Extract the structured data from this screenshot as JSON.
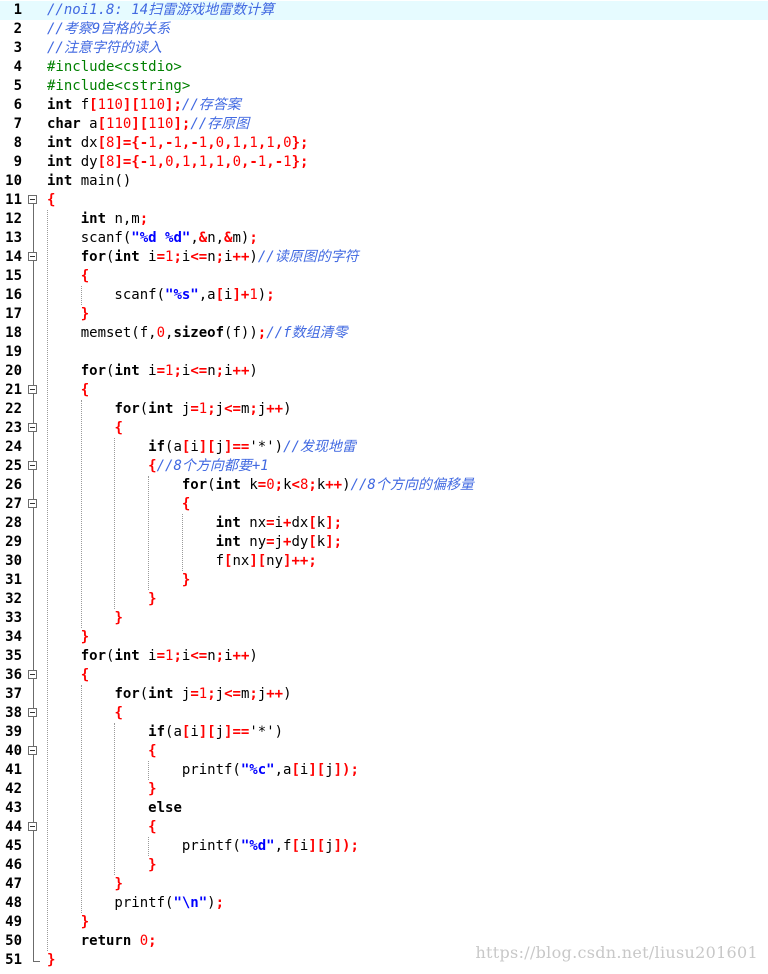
{
  "editor": {
    "current_line": 1,
    "watermark": "https://blog.csdn.net/liusu201601"
  },
  "fold_lines": [
    11,
    14,
    21,
    23,
    25,
    27,
    36,
    38,
    40,
    44
  ],
  "lines": [
    {
      "n": "1",
      "tokens": [
        [
          "cmt",
          "//noi1.8: 14扫雷游戏地雷数计算"
        ]
      ]
    },
    {
      "n": "2",
      "tokens": [
        [
          "cmt",
          "//考察9宫格的关系"
        ]
      ]
    },
    {
      "n": "3",
      "tokens": [
        [
          "cmt",
          "//注意字符的读入"
        ]
      ]
    },
    {
      "n": "4",
      "tokens": [
        [
          "pp",
          "#include<cstdio>"
        ]
      ]
    },
    {
      "n": "5",
      "tokens": [
        [
          "pp",
          "#include<cstring>"
        ]
      ]
    },
    {
      "n": "6",
      "tokens": [
        [
          "kw",
          "int"
        ],
        [
          "id",
          " f"
        ],
        [
          "op",
          "["
        ],
        [
          "num",
          "110"
        ],
        [
          "op",
          "]["
        ],
        [
          "num",
          "110"
        ],
        [
          "op",
          "];"
        ],
        [
          "cmt",
          "//存答案"
        ]
      ]
    },
    {
      "n": "7",
      "tokens": [
        [
          "kw",
          "char"
        ],
        [
          "id",
          " a"
        ],
        [
          "op",
          "["
        ],
        [
          "num",
          "110"
        ],
        [
          "op",
          "]["
        ],
        [
          "num",
          "110"
        ],
        [
          "op",
          "];"
        ],
        [
          "cmt",
          "//存原图"
        ]
      ]
    },
    {
      "n": "8",
      "tokens": [
        [
          "kw",
          "int"
        ],
        [
          "id",
          " dx"
        ],
        [
          "op",
          "["
        ],
        [
          "num",
          "8"
        ],
        [
          "op",
          "]={-"
        ],
        [
          "num",
          "1"
        ],
        [
          "op",
          ",-"
        ],
        [
          "num",
          "1"
        ],
        [
          "op",
          ",-"
        ],
        [
          "num",
          "1"
        ],
        [
          "op",
          ","
        ],
        [
          "num",
          "0"
        ],
        [
          "op",
          ","
        ],
        [
          "num",
          "1"
        ],
        [
          "op",
          ","
        ],
        [
          "num",
          "1"
        ],
        [
          "op",
          ","
        ],
        [
          "num",
          "1"
        ],
        [
          "op",
          ","
        ],
        [
          "num",
          "0"
        ],
        [
          "op",
          "};"
        ]
      ]
    },
    {
      "n": "9",
      "tokens": [
        [
          "kw",
          "int"
        ],
        [
          "id",
          " dy"
        ],
        [
          "op",
          "["
        ],
        [
          "num",
          "8"
        ],
        [
          "op",
          "]={-"
        ],
        [
          "num",
          "1"
        ],
        [
          "op",
          ","
        ],
        [
          "num",
          "0"
        ],
        [
          "op",
          ","
        ],
        [
          "num",
          "1"
        ],
        [
          "op",
          ","
        ],
        [
          "num",
          "1"
        ],
        [
          "op",
          ","
        ],
        [
          "num",
          "1"
        ],
        [
          "op",
          ","
        ],
        [
          "num",
          "0"
        ],
        [
          "op",
          ",-"
        ],
        [
          "num",
          "1"
        ],
        [
          "op",
          ",-"
        ],
        [
          "num",
          "1"
        ],
        [
          "op",
          "};"
        ]
      ]
    },
    {
      "n": "10",
      "tokens": [
        [
          "kw",
          "int"
        ],
        [
          "id",
          " main()"
        ]
      ]
    },
    {
      "n": "11",
      "tokens": [
        [
          "op",
          "{"
        ]
      ]
    },
    {
      "n": "12",
      "tokens": [
        [
          "id",
          "    "
        ],
        [
          "kw",
          "int"
        ],
        [
          "id",
          " n,m"
        ],
        [
          "op",
          ";"
        ]
      ]
    },
    {
      "n": "13",
      "tokens": [
        [
          "id",
          "    scanf("
        ],
        [
          "str",
          "\"%d %d\""
        ],
        [
          "id",
          ","
        ],
        [
          "op",
          "&"
        ],
        [
          "id",
          "n,"
        ],
        [
          "op",
          "&"
        ],
        [
          "id",
          "m)"
        ],
        [
          "op",
          ";"
        ]
      ]
    },
    {
      "n": "14",
      "tokens": [
        [
          "id",
          "    "
        ],
        [
          "kw",
          "for"
        ],
        [
          "id",
          "("
        ],
        [
          "kw",
          "int"
        ],
        [
          "id",
          " i"
        ],
        [
          "op",
          "="
        ],
        [
          "num",
          "1"
        ],
        [
          "op",
          ";"
        ],
        [
          "id",
          "i"
        ],
        [
          "op",
          "<="
        ],
        [
          "id",
          "n"
        ],
        [
          "op",
          ";"
        ],
        [
          "id",
          "i"
        ],
        [
          "op",
          "++"
        ],
        [
          "id",
          ")"
        ],
        [
          "cmt",
          "//读原图的字符"
        ]
      ]
    },
    {
      "n": "15",
      "tokens": [
        [
          "id",
          "    "
        ],
        [
          "op",
          "{"
        ]
      ]
    },
    {
      "n": "16",
      "tokens": [
        [
          "id",
          "        scanf("
        ],
        [
          "str",
          "\"%s\""
        ],
        [
          "id",
          ",a"
        ],
        [
          "op",
          "["
        ],
        [
          "id",
          "i"
        ],
        [
          "op",
          "]+"
        ],
        [
          "num",
          "1"
        ],
        [
          "id",
          ")"
        ],
        [
          "op",
          ";"
        ]
      ]
    },
    {
      "n": "17",
      "tokens": [
        [
          "id",
          "    "
        ],
        [
          "op",
          "}"
        ]
      ]
    },
    {
      "n": "18",
      "tokens": [
        [
          "id",
          "    memset(f,"
        ],
        [
          "num",
          "0"
        ],
        [
          "id",
          ","
        ],
        [
          "kw",
          "sizeof"
        ],
        [
          "id",
          "(f))"
        ],
        [
          "op",
          ";"
        ],
        [
          "cmt",
          "//f数组清零"
        ]
      ]
    },
    {
      "n": "19",
      "tokens": []
    },
    {
      "n": "20",
      "tokens": [
        [
          "id",
          "    "
        ],
        [
          "kw",
          "for"
        ],
        [
          "id",
          "("
        ],
        [
          "kw",
          "int"
        ],
        [
          "id",
          " i"
        ],
        [
          "op",
          "="
        ],
        [
          "num",
          "1"
        ],
        [
          "op",
          ";"
        ],
        [
          "id",
          "i"
        ],
        [
          "op",
          "<="
        ],
        [
          "id",
          "n"
        ],
        [
          "op",
          ";"
        ],
        [
          "id",
          "i"
        ],
        [
          "op",
          "++"
        ],
        [
          "id",
          ")"
        ]
      ]
    },
    {
      "n": "21",
      "tokens": [
        [
          "id",
          "    "
        ],
        [
          "op",
          "{"
        ]
      ]
    },
    {
      "n": "22",
      "tokens": [
        [
          "id",
          "        "
        ],
        [
          "kw",
          "for"
        ],
        [
          "id",
          "("
        ],
        [
          "kw",
          "int"
        ],
        [
          "id",
          " j"
        ],
        [
          "op",
          "="
        ],
        [
          "num",
          "1"
        ],
        [
          "op",
          ";"
        ],
        [
          "id",
          "j"
        ],
        [
          "op",
          "<="
        ],
        [
          "id",
          "m"
        ],
        [
          "op",
          ";"
        ],
        [
          "id",
          "j"
        ],
        [
          "op",
          "++"
        ],
        [
          "id",
          ")"
        ]
      ]
    },
    {
      "n": "23",
      "tokens": [
        [
          "id",
          "        "
        ],
        [
          "op",
          "{"
        ]
      ]
    },
    {
      "n": "24",
      "tokens": [
        [
          "id",
          "            "
        ],
        [
          "kw",
          "if"
        ],
        [
          "id",
          "(a"
        ],
        [
          "op",
          "["
        ],
        [
          "id",
          "i"
        ],
        [
          "op",
          "]["
        ],
        [
          "id",
          "j"
        ],
        [
          "op",
          "]=="
        ],
        [
          "chr",
          "'*'"
        ],
        [
          "id",
          ")"
        ],
        [
          "cmt",
          "//发现地雷"
        ]
      ]
    },
    {
      "n": "25",
      "tokens": [
        [
          "id",
          "            "
        ],
        [
          "op",
          "{"
        ],
        [
          "cmt",
          "//8个方向都要+1"
        ]
      ]
    },
    {
      "n": "26",
      "tokens": [
        [
          "id",
          "                "
        ],
        [
          "kw",
          "for"
        ],
        [
          "id",
          "("
        ],
        [
          "kw",
          "int"
        ],
        [
          "id",
          " k"
        ],
        [
          "op",
          "="
        ],
        [
          "num",
          "0"
        ],
        [
          "op",
          ";"
        ],
        [
          "id",
          "k"
        ],
        [
          "op",
          "<"
        ],
        [
          "num",
          "8"
        ],
        [
          "op",
          ";"
        ],
        [
          "id",
          "k"
        ],
        [
          "op",
          "++"
        ],
        [
          "id",
          ")"
        ],
        [
          "cmt",
          "//8个方向的偏移量"
        ]
      ]
    },
    {
      "n": "27",
      "tokens": [
        [
          "id",
          "                "
        ],
        [
          "op",
          "{"
        ]
      ]
    },
    {
      "n": "28",
      "tokens": [
        [
          "id",
          "                    "
        ],
        [
          "kw",
          "int"
        ],
        [
          "id",
          " nx"
        ],
        [
          "op",
          "="
        ],
        [
          "id",
          "i"
        ],
        [
          "op",
          "+"
        ],
        [
          "id",
          "dx"
        ],
        [
          "op",
          "["
        ],
        [
          "id",
          "k"
        ],
        [
          "op",
          "];"
        ]
      ]
    },
    {
      "n": "29",
      "tokens": [
        [
          "id",
          "                    "
        ],
        [
          "kw",
          "int"
        ],
        [
          "id",
          " ny"
        ],
        [
          "op",
          "="
        ],
        [
          "id",
          "j"
        ],
        [
          "op",
          "+"
        ],
        [
          "id",
          "dy"
        ],
        [
          "op",
          "["
        ],
        [
          "id",
          "k"
        ],
        [
          "op",
          "];"
        ]
      ]
    },
    {
      "n": "30",
      "tokens": [
        [
          "id",
          "                    f"
        ],
        [
          "op",
          "["
        ],
        [
          "id",
          "nx"
        ],
        [
          "op",
          "]["
        ],
        [
          "id",
          "ny"
        ],
        [
          "op",
          "]++;"
        ]
      ]
    },
    {
      "n": "31",
      "tokens": [
        [
          "id",
          "                "
        ],
        [
          "op",
          "}"
        ]
      ]
    },
    {
      "n": "32",
      "tokens": [
        [
          "id",
          "            "
        ],
        [
          "op",
          "}"
        ]
      ]
    },
    {
      "n": "33",
      "tokens": [
        [
          "id",
          "        "
        ],
        [
          "op",
          "}"
        ]
      ]
    },
    {
      "n": "34",
      "tokens": [
        [
          "id",
          "    "
        ],
        [
          "op",
          "}"
        ]
      ]
    },
    {
      "n": "35",
      "tokens": [
        [
          "id",
          "    "
        ],
        [
          "kw",
          "for"
        ],
        [
          "id",
          "("
        ],
        [
          "kw",
          "int"
        ],
        [
          "id",
          " i"
        ],
        [
          "op",
          "="
        ],
        [
          "num",
          "1"
        ],
        [
          "op",
          ";"
        ],
        [
          "id",
          "i"
        ],
        [
          "op",
          "<="
        ],
        [
          "id",
          "n"
        ],
        [
          "op",
          ";"
        ],
        [
          "id",
          "i"
        ],
        [
          "op",
          "++"
        ],
        [
          "id",
          ")"
        ]
      ]
    },
    {
      "n": "36",
      "tokens": [
        [
          "id",
          "    "
        ],
        [
          "op",
          "{"
        ]
      ]
    },
    {
      "n": "37",
      "tokens": [
        [
          "id",
          "        "
        ],
        [
          "kw",
          "for"
        ],
        [
          "id",
          "("
        ],
        [
          "kw",
          "int"
        ],
        [
          "id",
          " j"
        ],
        [
          "op",
          "="
        ],
        [
          "num",
          "1"
        ],
        [
          "op",
          ";"
        ],
        [
          "id",
          "j"
        ],
        [
          "op",
          "<="
        ],
        [
          "id",
          "m"
        ],
        [
          "op",
          ";"
        ],
        [
          "id",
          "j"
        ],
        [
          "op",
          "++"
        ],
        [
          "id",
          ")"
        ]
      ]
    },
    {
      "n": "38",
      "tokens": [
        [
          "id",
          "        "
        ],
        [
          "op",
          "{"
        ]
      ]
    },
    {
      "n": "39",
      "tokens": [
        [
          "id",
          "            "
        ],
        [
          "kw",
          "if"
        ],
        [
          "id",
          "(a"
        ],
        [
          "op",
          "["
        ],
        [
          "id",
          "i"
        ],
        [
          "op",
          "]["
        ],
        [
          "id",
          "j"
        ],
        [
          "op",
          "]=="
        ],
        [
          "chr",
          "'*'"
        ],
        [
          "id",
          ")"
        ]
      ]
    },
    {
      "n": "40",
      "tokens": [
        [
          "id",
          "            "
        ],
        [
          "op",
          "{"
        ]
      ]
    },
    {
      "n": "41",
      "tokens": [
        [
          "id",
          "                printf("
        ],
        [
          "str",
          "\"%c\""
        ],
        [
          "id",
          ",a"
        ],
        [
          "op",
          "["
        ],
        [
          "id",
          "i"
        ],
        [
          "op",
          "]["
        ],
        [
          "id",
          "j"
        ],
        [
          "op",
          "])"
        ],
        [
          "op",
          ";"
        ]
      ]
    },
    {
      "n": "42",
      "tokens": [
        [
          "id",
          "            "
        ],
        [
          "op",
          "}"
        ]
      ]
    },
    {
      "n": "43",
      "tokens": [
        [
          "id",
          "            "
        ],
        [
          "kw",
          "else"
        ]
      ]
    },
    {
      "n": "44",
      "tokens": [
        [
          "id",
          "            "
        ],
        [
          "op",
          "{"
        ]
      ]
    },
    {
      "n": "45",
      "tokens": [
        [
          "id",
          "                printf("
        ],
        [
          "str",
          "\"%d\""
        ],
        [
          "id",
          ",f"
        ],
        [
          "op",
          "["
        ],
        [
          "id",
          "i"
        ],
        [
          "op",
          "]["
        ],
        [
          "id",
          "j"
        ],
        [
          "op",
          "])"
        ],
        [
          "op",
          ";"
        ]
      ]
    },
    {
      "n": "46",
      "tokens": [
        [
          "id",
          "            "
        ],
        [
          "op",
          "}"
        ]
      ]
    },
    {
      "n": "47",
      "tokens": [
        [
          "id",
          "        "
        ],
        [
          "op",
          "}"
        ]
      ]
    },
    {
      "n": "48",
      "tokens": [
        [
          "id",
          "        printf("
        ],
        [
          "str",
          "\"\\n\""
        ],
        [
          "id",
          ")"
        ],
        [
          "op",
          ";"
        ]
      ]
    },
    {
      "n": "49",
      "tokens": [
        [
          "id",
          "    "
        ],
        [
          "op",
          "}"
        ]
      ]
    },
    {
      "n": "50",
      "tokens": [
        [
          "id",
          "    "
        ],
        [
          "kw",
          "return"
        ],
        [
          "id",
          " "
        ],
        [
          "num",
          "0"
        ],
        [
          "op",
          ";"
        ]
      ]
    },
    {
      "n": "51",
      "tokens": [
        [
          "op",
          "}"
        ]
      ]
    }
  ]
}
